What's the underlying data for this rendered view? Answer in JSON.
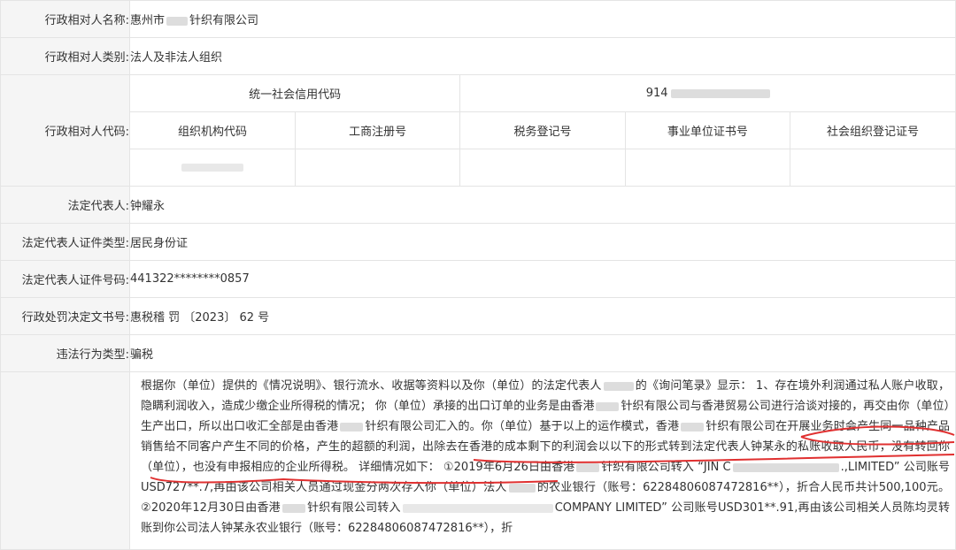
{
  "labels": {
    "name": "行政相对人名称:",
    "category": "行政相对人类别:",
    "code": "行政相对人代码:",
    "legal_rep": "法定代表人:",
    "id_type": "法定代表人证件类型:",
    "id_number": "法定代表人证件号码:",
    "decision_no": "行政处罚决定文书号:",
    "violation_type": "违法行为类型:"
  },
  "values": {
    "name_prefix": "惠州市",
    "name_suffix": "针织有限公司",
    "category": "法人及非法人组织",
    "legal_rep": "钟耀永",
    "id_type": "居民身份证",
    "id_number": "441322********0857",
    "decision_no": "惠税稽 罚 〔2023〕 62 号",
    "violation_type": "骗税"
  },
  "codes": {
    "credit_code_header": "统一社会信用代码",
    "credit_code_prefix": "914",
    "headers": [
      "组织机构代码",
      "工商注册号",
      "税务登记号",
      "事业单位证书号",
      "社会组织登记证号"
    ]
  },
  "description": {
    "p1": "根据你（单位）提供的《情况说明》、银行流水、收据等资料以及你（单位）的法定代表人",
    "p2": "的《询问笔录》显示：  1、存在境外利润通过私人账户收取，隐瞒利润收入，造成少缴企业所得税的情况；  你（单位）承接的出口订单的业务是由香港",
    "p3": "针织有限公司与香港贸易公司进行洽谈对接的，再交由你（单位）生产出口，所以出口收汇全部是由香港",
    "p4": "针织有限公司汇入的。你（单位）基于以上的运作模式，",
    "u1": "香港",
    "u2": "针织有限公司在开展业务时会产生同一品种产品销售给不同客户产生不同的价格，产生的超额的利润，出除去在香港的成本剩下的利润会以以下的形式转到法定代表人钟某永的私账收取人民币，没有转回你（单位），也没有申报相应的企业所得税。",
    "p5": "  详细情况如下：  ①2019年6月26日由香港",
    "p6": "针织有限公司转入 “JIN C",
    "p7": ".,LIMITED” 公司账号USD727**.7,再由该公司相关人员通过现金分两次存入你（单位）法人",
    "p8": "的农业银行（账号：62284806087472816**），折合人民币共计500,100元。  ②2020年12月30日由香港",
    "p9": "针织有限公司转入",
    "p10": "COMPANY LIMITED” 公司账号USD301**.91,再由该公司相关人员陈均灵转账到你公司法人钟某永农业银行（账号：62284806087472816**），折"
  }
}
